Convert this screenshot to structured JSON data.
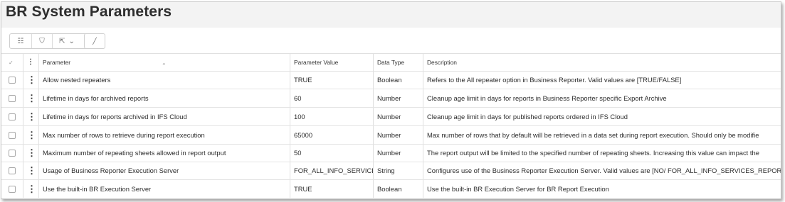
{
  "page": {
    "title": "BR System Parameters"
  },
  "toolbar": {
    "buttons": [
      {
        "icon": "column-chooser-icon",
        "glyph": "☷"
      },
      {
        "icon": "filter-icon",
        "glyph": "⛉"
      },
      {
        "icon": "export-icon",
        "glyph": "⇱"
      },
      {
        "icon": "chevron-down-icon",
        "glyph": "⌄"
      },
      {
        "icon": "edit-icon",
        "glyph": "╱"
      }
    ]
  },
  "table": {
    "header": {
      "check_glyph": "✓",
      "menu_glyph": "⋮",
      "sort_glyph": "⌃",
      "columns": [
        "Parameter",
        "Parameter Value",
        "Data Type",
        "Description"
      ]
    },
    "rows": [
      {
        "parameter": "Allow nested repeaters",
        "value": "TRUE",
        "type": "Boolean",
        "description": "Refers to the All repeater option in Business Reporter. Valid values are [TRUE/FALSE]"
      },
      {
        "parameter": "Lifetime in days for archived reports",
        "value": "60",
        "type": "Number",
        "description": "Cleanup age limit in days for reports in Business Reporter specific Export Archive"
      },
      {
        "parameter": "Lifetime in days for reports archived in IFS Cloud",
        "value": "100",
        "type": "Number",
        "description": "Cleanup age limit in days for published reports ordered in IFS Cloud"
      },
      {
        "parameter": "Max number of rows to retrieve during report execution",
        "value": "65000",
        "type": "Number",
        "description": "Max number of rows that by default will be retrieved in a data set during report execution. Should only be modifie"
      },
      {
        "parameter": "Maximum number of repeating sheets allowed in report output",
        "value": "50",
        "type": "Number",
        "description": "The report output will be limited to the specified number of repeating sheets. Increasing this value can impact the"
      },
      {
        "parameter": "Usage of Business Reporter Execution Server",
        "value": "FOR_ALL_INFO_SERVICES",
        "type": "String",
        "description": "Configures use of the Business Reporter Execution Server. Valid values are [NO/ FOR_ALL_INFO_SERVICES_REPORT"
      },
      {
        "parameter": "Use the built-in BR Execution Server",
        "value": "TRUE",
        "type": "Boolean",
        "description": "Use the built-in BR Execution Server for BR Report Execution"
      }
    ],
    "row_menu_glyph": "⋮"
  }
}
